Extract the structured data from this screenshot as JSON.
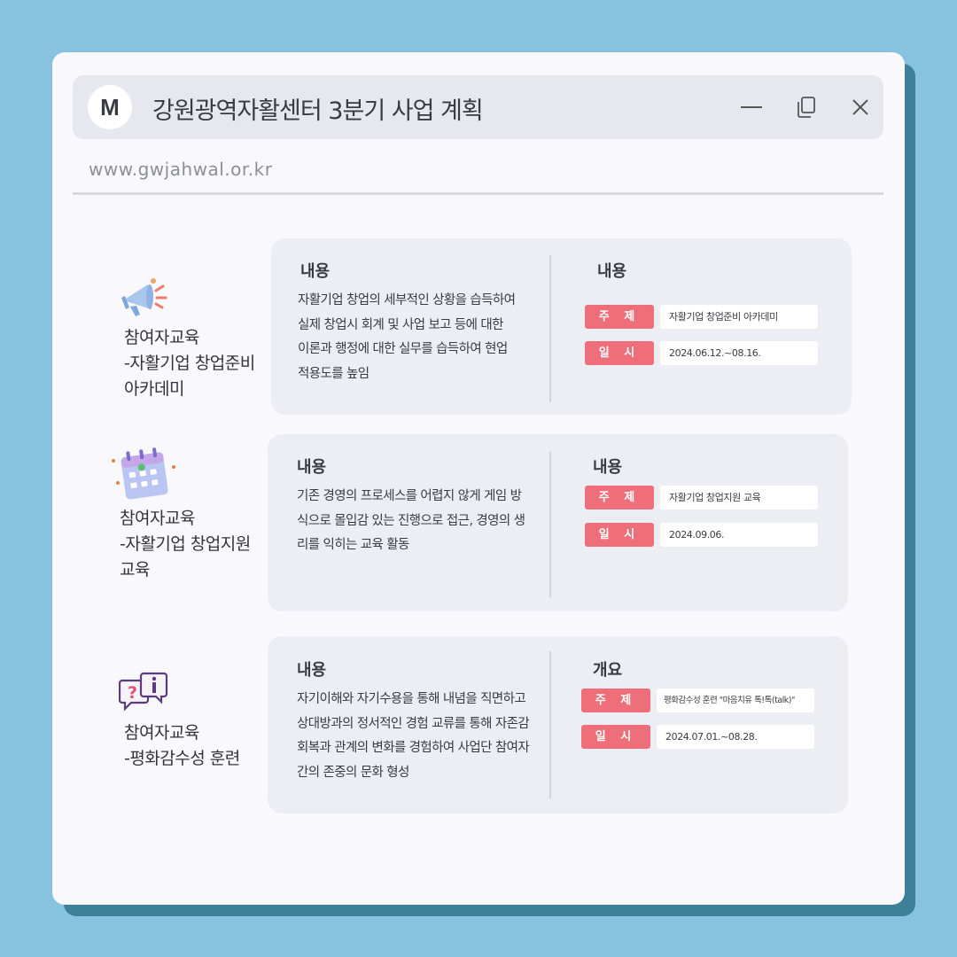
{
  "window": {
    "logo_letter": "M",
    "title": "강원광역자활센터 3분기 사업 계획",
    "url": "www.gwjahwal.or.kr",
    "controls": [
      "minimize-icon",
      "restore-icon",
      "close-icon"
    ]
  },
  "items": [
    {
      "icon": "megaphone-icon",
      "label_lines": [
        "참여자교육",
        "-자활기업 창업준비",
        "아카데미"
      ],
      "left_heading": "내용",
      "description_lines": [
        "자활기업 창업의 세부적인 상황을 습득하여",
        "실제 창업시 회계 및 사업 보고 등에 대한",
        "이론과 행정에 대한 실무를 습득하여 현업",
        "적용도를 높임"
      ],
      "right_heading": "내용",
      "topic_label": "주 제",
      "topic": "자활기업 창업준비 아카데미",
      "date_label": "일 시",
      "date": "2024.06.12.~08.16."
    },
    {
      "icon": "calendar-icon",
      "label_lines": [
        "참여자교육",
        "-자활기업 창업지원",
        "교육"
      ],
      "left_heading": "내용",
      "description_lines": [
        "기존 경영의 프로세스를 어렵지 않게 게임 방",
        "식으로 몰입감 있는 진행으로 접근, 경영의 생",
        "리를 익히는 교육 활동"
      ],
      "right_heading": "내용",
      "topic_label": "주 제",
      "topic": "자활기업 창업지원 교육",
      "date_label": "일 시",
      "date": "2024.09.06."
    },
    {
      "icon": "question-info-icon",
      "label_lines": [
        "참여자교육",
        "-평화감수성 훈련"
      ],
      "left_heading": "내용",
      "description_lines": [
        "자기이해와 자기수용을 통해 내념을 직면하고",
        "상대방과의 정서적인 경험 교류를 통해 자존감",
        "회복과 관계의 변화를 경험하여 사업단 참여자",
        "간의 존중의 문화 형성"
      ],
      "right_heading": "개요",
      "topic_label": "주 제",
      "topic": "평화감수성 훈련 \"마음치유 톡!톡(talk)\"",
      "date_label": "일 시",
      "date": "2024.07.01.~08.28."
    }
  ],
  "colors": {
    "background": "#87c3e0",
    "window_shadow": "#3f8099",
    "pill": "#ee6f79",
    "card": "#ededf4"
  }
}
